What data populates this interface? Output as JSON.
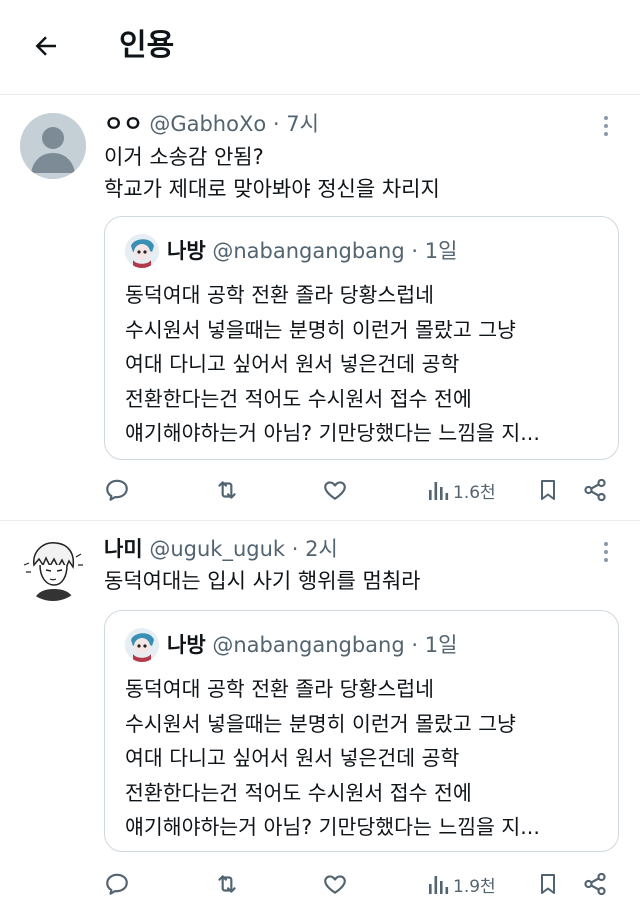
{
  "header": {
    "title": "인용"
  },
  "tweets": [
    {
      "name": "ㅇㅇ",
      "handle": "@GabhoXo",
      "dot": "·",
      "time": "7시",
      "text": "이거 소송감 안됨?\n학교가 제대로 맞아봐야 정신을 차리지",
      "quote": {
        "name": "나방",
        "handle": "@nabangangbang",
        "dot": "·",
        "time": "1일",
        "text": "동덕여대 공학 전환 졸라 당황스럽네\n수시원서 넣을때는 분명히 이런거 몰랐고 그냥\n여대 다니고 싶어서 원서 넣은건데 공학\n전환한다는건 적어도 수시원서 접수 전에\n얘기해야하는거 아님? 기만당했다는 느낌을 지..."
      },
      "views": "1.6천"
    },
    {
      "name": "나미",
      "handle": "@uguk_uguk",
      "dot": "·",
      "time": "2시",
      "text": "동덕여대는 입시 사기 행위를 멈춰라",
      "quote": {
        "name": "나방",
        "handle": "@nabangangbang",
        "dot": "·",
        "time": "1일",
        "text": "동덕여대 공학 전환 졸라 당황스럽네\n수시원서 넣을때는 분명히 이런거 몰랐고 그냥\n여대 다니고 싶어서 원서 넣은건데 공학\n전환한다는건 적어도 수시원서 접수 전에\n얘기해야하는거 아님? 기만당했다는 느낌을 지..."
      },
      "views": "1.9천"
    }
  ],
  "icons": {
    "back": "back-arrow-icon",
    "reply": "reply-icon",
    "retweet": "retweet-icon",
    "like": "heart-icon",
    "views": "views-icon",
    "bookmark": "bookmark-icon",
    "share": "share-icon",
    "more": "more-icon"
  },
  "colors": {
    "text": "#0f1419",
    "muted": "#536471",
    "border": "#cfd9de",
    "divider": "#e8ecef"
  }
}
